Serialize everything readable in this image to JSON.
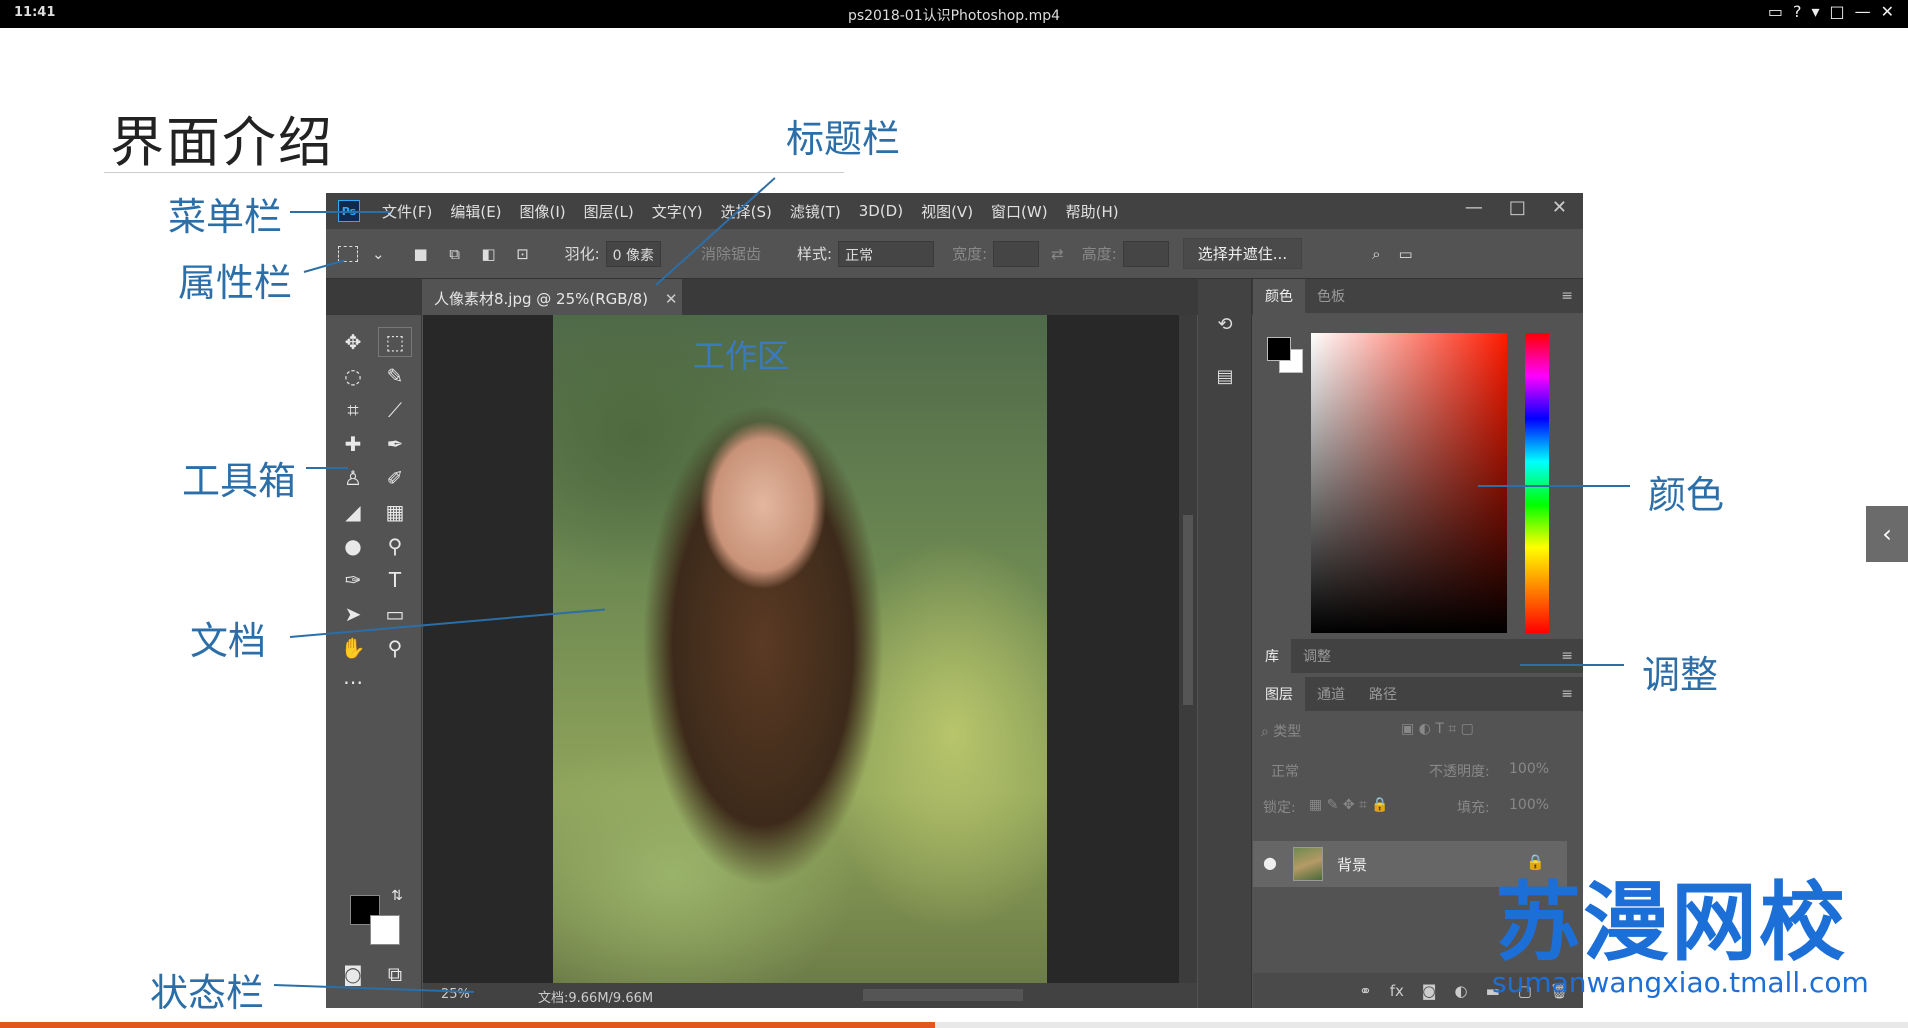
{
  "player": {
    "time": "11:41",
    "title": "ps2018-01认识Photoshop.mp4",
    "controls": [
      "▭",
      "?",
      "▾",
      "□",
      "—",
      "✕"
    ],
    "progress": 0.49
  },
  "slide": {
    "title": "界面介绍",
    "annotations": {
      "title_bar": "标题栏",
      "menu_bar": "菜单栏",
      "options_bar": "属性栏",
      "toolbox": "工具箱",
      "document": "文档",
      "status_bar": "状态栏",
      "color": "颜色",
      "adjust": "调整"
    }
  },
  "photoshop": {
    "logo": "Ps",
    "menus": [
      "文件(F)",
      "编辑(E)",
      "图像(I)",
      "图层(L)",
      "文字(Y)",
      "选择(S)",
      "滤镜(T)",
      "3D(D)",
      "视图(V)",
      "窗口(W)",
      "帮助(H)"
    ],
    "window_controls": [
      "—",
      "□",
      "✕"
    ],
    "options": {
      "feather_label": "羽化:",
      "feather_value": "0 像素",
      "antialias_label": "消除锯齿",
      "style_label": "样式:",
      "style_value": "正常",
      "width_label": "宽度:",
      "height_label": "高度:",
      "select_mask_button": "选择并遮住..."
    },
    "doc_tab": {
      "name": "人像素材8.jpg @ 25%(RGB/8)",
      "close": "✕"
    },
    "workspace_label": "工作区",
    "status": {
      "zoom": "25%",
      "doc": "文档:9.66M/9.66M"
    },
    "panels": {
      "color_tabs": [
        "颜色",
        "色板"
      ],
      "library_tabs": [
        "库",
        "调整"
      ],
      "layer_tabs": [
        "图层",
        "通道",
        "路径"
      ],
      "filter_kind": "类型",
      "blend_mode": "正常",
      "opacity_label": "不透明度:",
      "opacity_value": "100%",
      "lock_label": "锁定:",
      "fill_label": "填充:",
      "fill_value": "100%",
      "layer_name": "背景",
      "footer_icons": [
        "link-icon",
        "fx-icon",
        "mask-icon",
        "adjustment-icon",
        "folder-icon",
        "new-layer-icon",
        "trash-icon"
      ]
    }
  },
  "watermark": {
    "brand": "苏漫网校",
    "url": "sumanwangxiao.tmall.com"
  },
  "colors": {
    "annotation": "#2c6ea8",
    "watermark": "#1d6fd8",
    "ps_panel": "#535353",
    "ps_dark": "#424242",
    "progress": "#e2571e"
  }
}
